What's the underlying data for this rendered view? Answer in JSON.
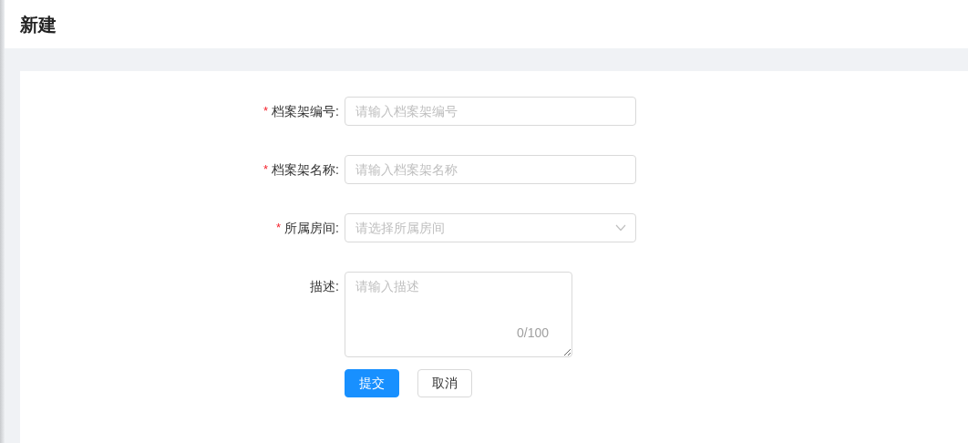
{
  "page": {
    "title": "新建"
  },
  "form": {
    "fields": [
      {
        "kind": "text",
        "label": "档案架编号:",
        "marker": "*",
        "placeholder": "请输入档案架编号"
      },
      {
        "kind": "text",
        "label": "档案架名称:",
        "marker": "*",
        "placeholder": "请输入档案架名称"
      },
      {
        "kind": "select",
        "label": "所属房间:",
        "marker": "*",
        "placeholder": "请选择所属房间"
      },
      {
        "kind": "textarea",
        "label": "描述:",
        "placeholder": "请输入描述",
        "counter": "0/100"
      }
    ],
    "buttons": [
      {
        "kind": "primary",
        "label": "提交"
      },
      {
        "kind": "default",
        "label": "取消"
      }
    ]
  }
}
